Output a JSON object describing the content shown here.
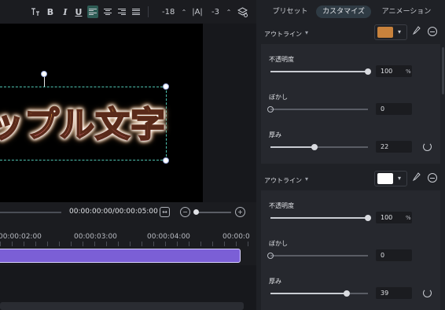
{
  "toolbar": {
    "font_size": "-18",
    "kerning": "-3",
    "buttons": [
      "bold",
      "italic",
      "underline",
      "align-left",
      "align-center",
      "align-right",
      "justify"
    ]
  },
  "preview": {
    "text": "ップル文字"
  },
  "timeline": {
    "timecode": "00:00:00:00/00:00:05:00",
    "ticks": [
      "00:00:02:00",
      "00:00:03:00",
      "00:00:04:00",
      "00:00:0"
    ]
  },
  "tabs": {
    "preset": "プリセット",
    "customize": "カスタマイズ",
    "animation": "アニメーション"
  },
  "outline1": {
    "label": "アウトライン",
    "color": "#c8823c",
    "opacity_label": "不透明度",
    "opacity_value": "100",
    "opacity_unit": "%",
    "opacity_level": 1.0,
    "blur_label": "ぼかし",
    "blur_value": "0",
    "blur_level": 0.0,
    "thickness_label": "厚み",
    "thickness_value": "22",
    "thickness_level": 0.45
  },
  "outline2": {
    "label": "アウトライン",
    "color": "#ffffff",
    "opacity_label": "不透明度",
    "opacity_value": "100",
    "opacity_unit": "%",
    "opacity_level": 1.0,
    "blur_label": "ぼかし",
    "blur_value": "0",
    "blur_level": 0.0,
    "thickness_label": "厚み",
    "thickness_value": "39",
    "thickness_level": 0.78
  },
  "colors": {
    "accent": "#4fc3b1",
    "clip": "#7b5fd6"
  }
}
